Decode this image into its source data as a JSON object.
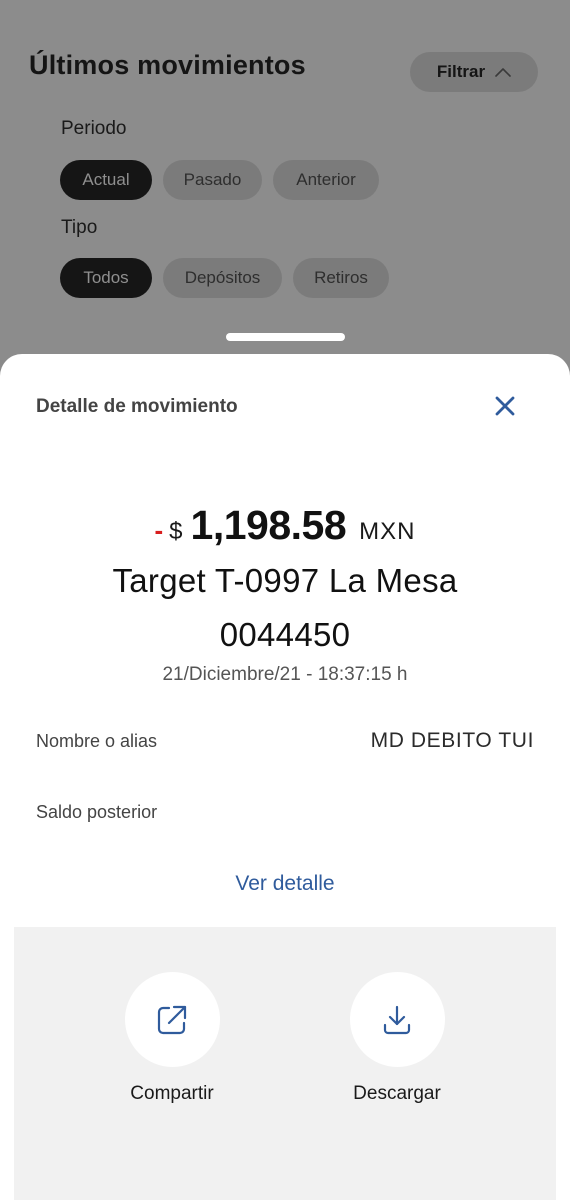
{
  "background": {
    "title": "Últimos movimientos",
    "filter_label": "Filtrar",
    "periodo_label": "Periodo",
    "periodo_options": [
      "Actual",
      "Pasado",
      "Anterior"
    ],
    "periodo_selected": "Actual",
    "tipo_label": "Tipo",
    "tipo_options": [
      "Todos",
      "Depósitos",
      "Retiros"
    ],
    "tipo_selected": "Todos"
  },
  "sheet": {
    "title": "Detalle de movimiento",
    "sign": "-",
    "currency_symbol": "$",
    "amount": "1,198.58",
    "currency": "MXN",
    "merchant_line1": "Target T-0997 La Mesa",
    "merchant_line2": "0044450",
    "datetime": "21/Diciembre/21 - 18:37:15 h",
    "fields": [
      {
        "label": "Nombre o alias",
        "value": "MD DEBITO TUI"
      },
      {
        "label": "Saldo posterior",
        "value": ""
      }
    ],
    "link_label": "Ver detalle",
    "actions": [
      {
        "label": "Compartir",
        "icon": "share-icon"
      },
      {
        "label": "Descargar",
        "icon": "download-icon"
      }
    ]
  },
  "colors": {
    "accent": "#2f5b9c",
    "negative": "#d81e1e",
    "overlay": "#8c8c8c"
  }
}
